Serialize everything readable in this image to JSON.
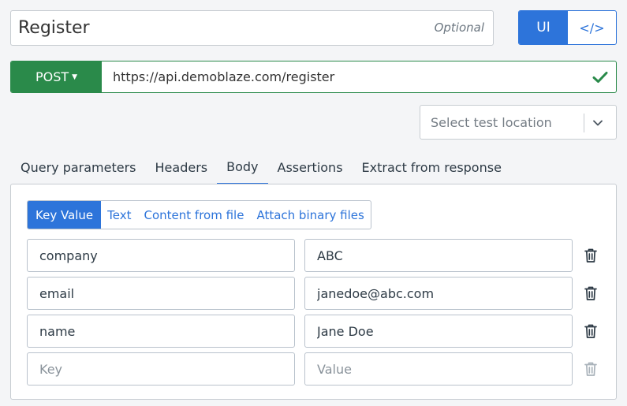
{
  "request": {
    "title": "Register",
    "title_hint": "Optional",
    "mode": {
      "ui_label": "UI",
      "code_label": "</>"
    },
    "method": "POST",
    "url": "https://api.demoblaze.com/register",
    "location_placeholder": "Select test location"
  },
  "tabs": [
    {
      "label": "Query parameters"
    },
    {
      "label": "Headers"
    },
    {
      "label": "Body",
      "active": true
    },
    {
      "label": "Assertions"
    },
    {
      "label": "Extract from response"
    }
  ],
  "body": {
    "types": [
      {
        "label": "Key Value",
        "active": true
      },
      {
        "label": "Text"
      },
      {
        "label": "Content from file"
      },
      {
        "label": "Attach binary files"
      }
    ],
    "rows": [
      {
        "key": "company",
        "value": "ABC"
      },
      {
        "key": "email",
        "value": "janedoe@abc.com"
      },
      {
        "key": "name",
        "value": "Jane Doe"
      },
      {
        "key": "",
        "value": ""
      }
    ],
    "key_placeholder": "Key",
    "value_placeholder": "Value"
  },
  "colors": {
    "primary": "#2d74da",
    "success": "#2a8a4a",
    "border": "#c7ccd1",
    "background": "#f4f5f7"
  },
  "icons": {
    "url_valid": "check-icon",
    "location_dropdown": "chevron-down-icon",
    "row_delete": "trash-icon"
  }
}
